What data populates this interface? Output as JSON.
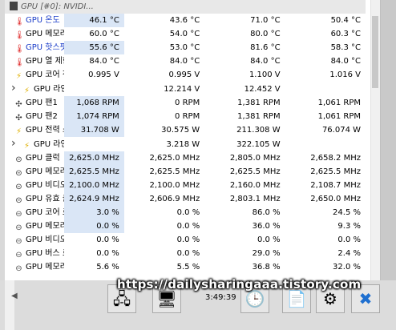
{
  "header": {
    "name": "GPU [#0]: NVIDI..."
  },
  "rows": [
    {
      "name": "GPU 온도",
      "icon": "thermometer-icon",
      "glyph": "🌡",
      "blue": true,
      "indent": 0,
      "expand": false,
      "v": [
        "46.1 °C",
        "43.6 °C",
        "71.0 °C",
        "50.4 °C"
      ],
      "hl": true
    },
    {
      "name": "GPU 메모리 접...",
      "icon": "thermometer-icon",
      "glyph": "🌡",
      "blue": false,
      "indent": 0,
      "expand": false,
      "v": [
        "60.0 °C",
        "54.0 °C",
        "80.0 °C",
        "60.3 °C"
      ],
      "hl": false
    },
    {
      "name": "GPU 핫스팟 온도",
      "icon": "thermometer-icon",
      "glyph": "🌡",
      "blue": true,
      "indent": 0,
      "expand": false,
      "v": [
        "55.6 °C",
        "53.0 °C",
        "81.6 °C",
        "58.3 °C"
      ],
      "hl": true
    },
    {
      "name": "GPU 열 제한",
      "icon": "thermometer-icon",
      "glyph": "🌡",
      "blue": false,
      "indent": 0,
      "expand": false,
      "v": [
        "84.0 °C",
        "84.0 °C",
        "84.0 °C",
        "84.0 °C"
      ],
      "hl": false
    },
    {
      "name": "GPU 코어 전압",
      "icon": "lightning-icon",
      "glyph": "⚡",
      "blue": false,
      "indent": 0,
      "expand": false,
      "v": [
        "0.995 V",
        "0.995 V",
        "1.100 V",
        "1.016 V"
      ],
      "hl": false
    },
    {
      "name": "GPU 라인 전압",
      "icon": "lightning-icon",
      "glyph": "⚡",
      "blue": false,
      "indent": 1,
      "expand": true,
      "v": [
        "",
        "12.214 V",
        "12.452 V",
        ""
      ],
      "hl": false
    },
    {
      "name": "GPU 팬1",
      "icon": "fan-icon",
      "glyph": "✣",
      "blue": false,
      "indent": 0,
      "expand": false,
      "v": [
        "1,068 RPM",
        "0 RPM",
        "1,381 RPM",
        "1,061 RPM"
      ],
      "hl": true
    },
    {
      "name": "GPU 팬2",
      "icon": "fan-icon",
      "glyph": "✣",
      "blue": false,
      "indent": 0,
      "expand": false,
      "v": [
        "1,074 RPM",
        "0 RPM",
        "1,381 RPM",
        "1,061 RPM"
      ],
      "hl": true
    },
    {
      "name": "GPU 전력 소비",
      "icon": "lightning-icon",
      "glyph": "⚡",
      "blue": false,
      "indent": 0,
      "expand": false,
      "v": [
        "31.708 W",
        "30.575 W",
        "211.308 W",
        "76.074 W"
      ],
      "hl": true
    },
    {
      "name": "GPU 라인 전...",
      "icon": "lightning-icon",
      "glyph": "⚡",
      "blue": false,
      "indent": 1,
      "expand": true,
      "v": [
        "",
        "3.218 W",
        "322.105 W",
        ""
      ],
      "hl": false
    },
    {
      "name": "GPU 클럭",
      "icon": "clock-icon",
      "glyph": "⊝",
      "blue": false,
      "indent": 0,
      "expand": false,
      "v": [
        "2,625.0 MHz",
        "2,625.0 MHz",
        "2,805.0 MHz",
        "2,658.2 MHz"
      ],
      "hl": true
    },
    {
      "name": "GPU 메모리 클럭",
      "icon": "clock-icon",
      "glyph": "⊝",
      "blue": false,
      "indent": 0,
      "expand": false,
      "v": [
        "2,625.5 MHz",
        "2,625.5 MHz",
        "2,625.5 MHz",
        "2,625.5 MHz"
      ],
      "hl": true
    },
    {
      "name": "GPU 비디오 클럭",
      "icon": "clock-icon",
      "glyph": "⊝",
      "blue": false,
      "indent": 0,
      "expand": false,
      "v": [
        "2,100.0 MHz",
        "2,100.0 MHz",
        "2,160.0 MHz",
        "2,108.7 MHz"
      ],
      "hl": true
    },
    {
      "name": "GPU 유효 클럭",
      "icon": "clock-icon",
      "glyph": "⊝",
      "blue": false,
      "indent": 0,
      "expand": false,
      "v": [
        "2,624.9 MHz",
        "2,606.9 MHz",
        "2,803.1 MHz",
        "2,650.0 MHz"
      ],
      "hl": true
    },
    {
      "name": "GPU 코어 로드",
      "icon": "gauge-icon",
      "glyph": "⊖",
      "blue": false,
      "indent": 0,
      "expand": false,
      "v": [
        "3.0 %",
        "0.0 %",
        "86.0 %",
        "24.5 %"
      ],
      "hl": true
    },
    {
      "name": "GPU 메모리 컨...",
      "icon": "gauge-icon",
      "glyph": "⊖",
      "blue": false,
      "indent": 0,
      "expand": false,
      "v": [
        "0.0 %",
        "0.0 %",
        "36.0 %",
        "9.3 %"
      ],
      "hl": true
    },
    {
      "name": "GPU 비디오 엔...",
      "icon": "gauge-icon",
      "glyph": "⊖",
      "blue": false,
      "indent": 0,
      "expand": false,
      "v": [
        "0.0 %",
        "0.0 %",
        "0.0 %",
        "0.0 %"
      ],
      "hl": false
    },
    {
      "name": "GPU 버스 로드",
      "icon": "gauge-icon",
      "glyph": "⊖",
      "blue": false,
      "indent": 0,
      "expand": false,
      "v": [
        "0.0 %",
        "0.0 %",
        "29.0 %",
        "2.4 %"
      ],
      "hl": false
    },
    {
      "name": "GPU 메모리 사...",
      "icon": "gauge-icon",
      "glyph": "⊖",
      "blue": false,
      "indent": 0,
      "expand": false,
      "v": [
        "5.6 %",
        "5.5 %",
        "36.8 %",
        "32.0 %"
      ],
      "hl": false
    }
  ],
  "watermark": "https://dailysharingaaa.tistory.com",
  "toolbar": {
    "time": "3:49:39",
    "buttons": [
      {
        "name": "network-monitor-button",
        "icon": "network-icon",
        "glyph": "🖧"
      },
      {
        "name": "remote-pc-button",
        "icon": "computer-icon",
        "glyph": "🖥"
      },
      {
        "name": "timer-clock-button",
        "icon": "clock-icon",
        "glyph": "🕒"
      },
      {
        "name": "add-log-button",
        "icon": "add-document-icon",
        "glyph": "📄"
      },
      {
        "name": "settings-button",
        "icon": "gear-icon",
        "glyph": "⚙"
      },
      {
        "name": "close-button",
        "icon": "close-icon",
        "glyph": "✖"
      }
    ]
  }
}
